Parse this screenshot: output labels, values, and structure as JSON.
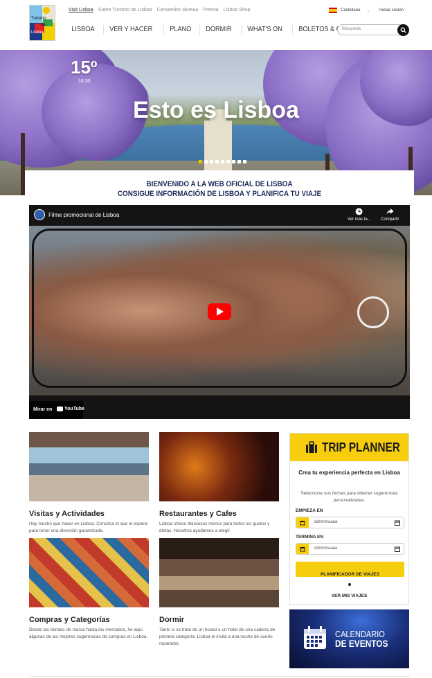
{
  "logo": {
    "line1": "Turismo",
    "line2": "de",
    "line3": "Lisboa"
  },
  "top_links": [
    {
      "label": "Visit Lisboa",
      "active": true
    },
    {
      "label": "Sobre Turismo de Lisboa"
    },
    {
      "label": "Convention Bureau"
    },
    {
      "label": "Prensa"
    },
    {
      "label": "Lisboa Shop"
    }
  ],
  "language": {
    "label": "Castellano"
  },
  "login": {
    "label": "Iniciar sesión"
  },
  "main_nav": [
    {
      "label": "LISBOA"
    },
    {
      "label": "VER Y HACER"
    },
    {
      "label": "PLANO"
    },
    {
      "label": "DORMIR"
    },
    {
      "label": "WHAT'S ON"
    },
    {
      "label": "BOLETOS & OFERTAS"
    }
  ],
  "search": {
    "placeholder": "Búsqueda"
  },
  "hero": {
    "temperature": "15º",
    "time": "16:30",
    "title": "Esto es Lisboa",
    "slides_total": 9,
    "active_slide": 0
  },
  "welcome": {
    "line1": "BIENVENIDO A LA WEB OFICIAL DE LISBOA",
    "line2": "CONSIGUE INFORMACIÓN DE LISBOA Y PLANIFICA TU VIAJE"
  },
  "video": {
    "title": "Filme promocional de Lisboa",
    "watch_later": "Ver más ta...",
    "share": "Compartir",
    "watch_on": "Mirar en",
    "youtube": "YouTube"
  },
  "cards": [
    {
      "title": "Visitas y Actividades",
      "desc": "Hay mucho que hacer en Lisboa. Conozca lo que le espera para tener una diversión garantizada."
    },
    {
      "title": "Restaurantes y Cafes",
      "desc": "Lisboa ofrece deliciosos menús para todos los gustos y dietas. Nosotros ayudamos a elegir."
    },
    {
      "title": "Compras y Categorías",
      "desc": "Desde las tiendas de marca hasta los mercados, he aquí algunas de las mejores sugerencias de compras en Lisboa."
    },
    {
      "title": "Dormir",
      "desc": "Tanto si se trata de un hostal o un hotel de una cadena de primera categoría, Lisboa le invita a una noche de sueño reparador."
    }
  ],
  "trip_planner": {
    "title": "TRIP PLANNER",
    "subtitle": "Crea tu experiencia perfecta en Lisboa",
    "hint": "Seleccione sus fechas para obtener sugerencias personalizadas.",
    "start_label": "EMPIEZA EN",
    "start_value": "dd/mm/aaaa",
    "end_label": "TERMINA EN",
    "end_value": "dd/mm/aaaa",
    "button": "PLANIFICADOR DE VIAJES",
    "my_trips": "VER MIS VIAJES"
  },
  "calendar_banner": {
    "line1": "CALENDARIO",
    "line2": "DE EVENTOS"
  },
  "colors": {
    "accent_yellow": "#f7ce0e",
    "heading_navy": "#1e2a5a",
    "youtube_red": "#ff0000"
  }
}
